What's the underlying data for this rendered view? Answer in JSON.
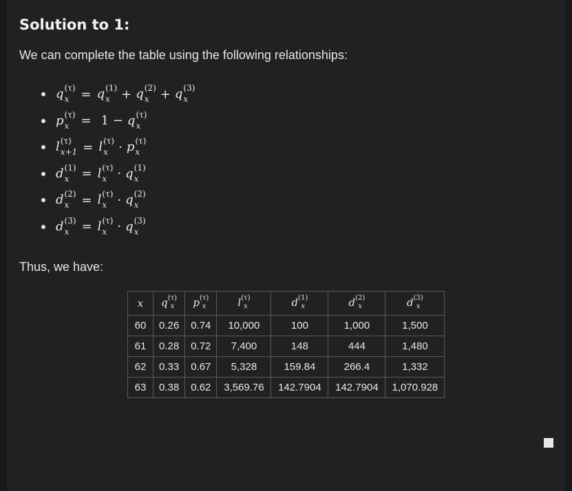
{
  "title": "Solution to 1:",
  "intro": "We can complete the table using the following relationships:",
  "formulas": [
    {
      "lhs_sym": "q",
      "lhs_up": "(τ)",
      "lhs_dn": "x",
      "rhs": [
        [
          "q",
          "(1)",
          "x"
        ],
        [
          "+"
        ],
        [
          "q",
          "(2)",
          "x"
        ],
        [
          "+"
        ],
        [
          "q",
          "(3)",
          "x"
        ]
      ]
    },
    {
      "lhs_sym": "p",
      "lhs_up": "(τ)",
      "lhs_dn": "x",
      "rhs": [
        [
          "1 −"
        ],
        [
          "q",
          "(τ)",
          "x"
        ]
      ]
    },
    {
      "lhs_sym": "l",
      "lhs_up": "(τ)",
      "lhs_dn": "x+1",
      "rhs": [
        [
          "l",
          "(τ)",
          "x"
        ],
        [
          "·"
        ],
        [
          "p",
          "(τ)",
          "x"
        ]
      ]
    },
    {
      "lhs_sym": "d",
      "lhs_up": "(1)",
      "lhs_dn": "x",
      "rhs": [
        [
          "l",
          "(τ)",
          "x"
        ],
        [
          "·"
        ],
        [
          "q",
          "(1)",
          "x"
        ]
      ]
    },
    {
      "lhs_sym": "d",
      "lhs_up": "(2)",
      "lhs_dn": "x",
      "rhs": [
        [
          "l",
          "(τ)",
          "x"
        ],
        [
          "·"
        ],
        [
          "q",
          "(2)",
          "x"
        ]
      ]
    },
    {
      "lhs_sym": "d",
      "lhs_up": "(3)",
      "lhs_dn": "x",
      "rhs": [
        [
          "l",
          "(τ)",
          "x"
        ],
        [
          "·"
        ],
        [
          "q",
          "(3)",
          "x"
        ]
      ]
    }
  ],
  "thus": "Thus, we have:",
  "table": {
    "headers": [
      {
        "sym": "x",
        "up": "",
        "dn": ""
      },
      {
        "sym": "q",
        "up": "(τ)",
        "dn": "x"
      },
      {
        "sym": "p",
        "up": "(τ)",
        "dn": "x"
      },
      {
        "sym": "l",
        "up": "(τ)",
        "dn": "x"
      },
      {
        "sym": "d",
        "up": "(1)",
        "dn": "x"
      },
      {
        "sym": "d",
        "up": "(2)",
        "dn": "x"
      },
      {
        "sym": "d",
        "up": "(3)",
        "dn": "x"
      }
    ],
    "rows": [
      [
        "60",
        "0.26",
        "0.74",
        "10,000",
        "100",
        "1,000",
        "1,500"
      ],
      [
        "61",
        "0.28",
        "0.72",
        "7,400",
        "148",
        "444",
        "1,480"
      ],
      [
        "62",
        "0.33",
        "0.67",
        "5,328",
        "159.84",
        "266.4",
        "1,332"
      ],
      [
        "63",
        "0.38",
        "0.62",
        "3,569.76",
        "142.7904",
        "142.7904",
        "1,070.928"
      ]
    ]
  }
}
